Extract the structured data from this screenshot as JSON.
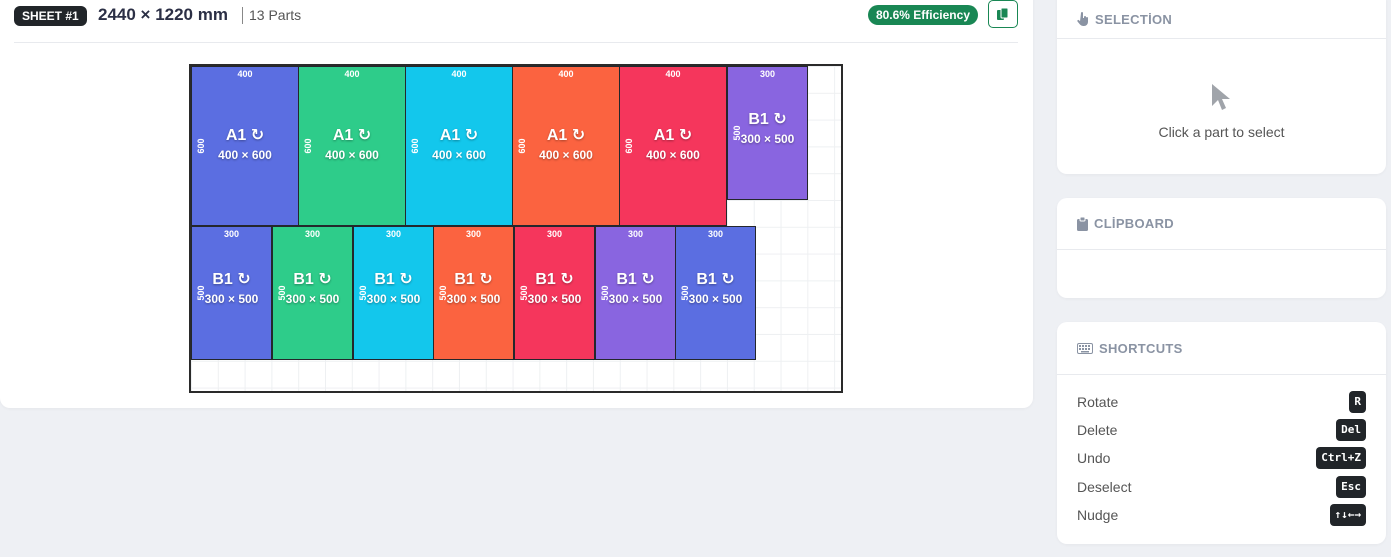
{
  "header": {
    "sheet_label": "SHEET #1",
    "dimensions": "2440 × 1220 mm",
    "parts_count": "13 Parts",
    "efficiency": "80.6% Efficiency"
  },
  "parts": [
    {
      "name": "A1 ↻",
      "size": "400 × 600",
      "w_label": "400",
      "h_label": "600",
      "color": "#5b6ee1"
    },
    {
      "name": "A1 ↻",
      "size": "400 × 600",
      "w_label": "400",
      "h_label": "600",
      "color": "#2ecc8a"
    },
    {
      "name": "A1 ↻",
      "size": "400 × 600",
      "w_label": "400",
      "h_label": "600",
      "color": "#13c7ec"
    },
    {
      "name": "A1 ↻",
      "size": "400 × 600",
      "w_label": "400",
      "h_label": "600",
      "color": "#fb6340"
    },
    {
      "name": "A1 ↻",
      "size": "400 × 600",
      "w_label": "400",
      "h_label": "600",
      "color": "#f5365c"
    },
    {
      "name": "B1 ↻",
      "size": "300 × 500",
      "w_label": "300",
      "h_label": "500",
      "color": "#8965e0"
    },
    {
      "name": "B1 ↻",
      "size": "300 × 500",
      "w_label": "300",
      "h_label": "500",
      "color": "#5b6ee1"
    },
    {
      "name": "B1 ↻",
      "size": "300 × 500",
      "w_label": "300",
      "h_label": "500",
      "color": "#2ecc8a"
    },
    {
      "name": "B1 ↻",
      "size": "300 × 500",
      "w_label": "300",
      "h_label": "500",
      "color": "#13c7ec"
    },
    {
      "name": "B1 ↻",
      "size": "300 × 500",
      "w_label": "300",
      "h_label": "500",
      "color": "#fb6340"
    },
    {
      "name": "B1 ↻",
      "size": "300 × 500",
      "w_label": "300",
      "h_label": "500",
      "color": "#f5365c"
    },
    {
      "name": "B1 ↻",
      "size": "300 × 500",
      "w_label": "300",
      "h_label": "500",
      "color": "#8965e0"
    },
    {
      "name": "B1 ↻",
      "size": "300 × 500",
      "w_label": "300",
      "h_label": "500",
      "color": "#5b6ee1"
    }
  ],
  "selection": {
    "title": "SELECTİON",
    "icon": "pointer-hand-icon",
    "empty_text": "Click a part to select"
  },
  "clipboard": {
    "title": "CLİPBOARD",
    "icon": "clipboard-icon"
  },
  "shortcuts": {
    "title": "SHORTCUTS",
    "icon": "keyboard-icon",
    "items": [
      {
        "label": "Rotate",
        "key": "R"
      },
      {
        "label": "Delete",
        "key": "Del"
      },
      {
        "label": "Undo",
        "key": "Ctrl+Z"
      },
      {
        "label": "Deselect",
        "key": "Esc"
      },
      {
        "label": "Nudge",
        "key": "↑↓←→"
      }
    ]
  }
}
